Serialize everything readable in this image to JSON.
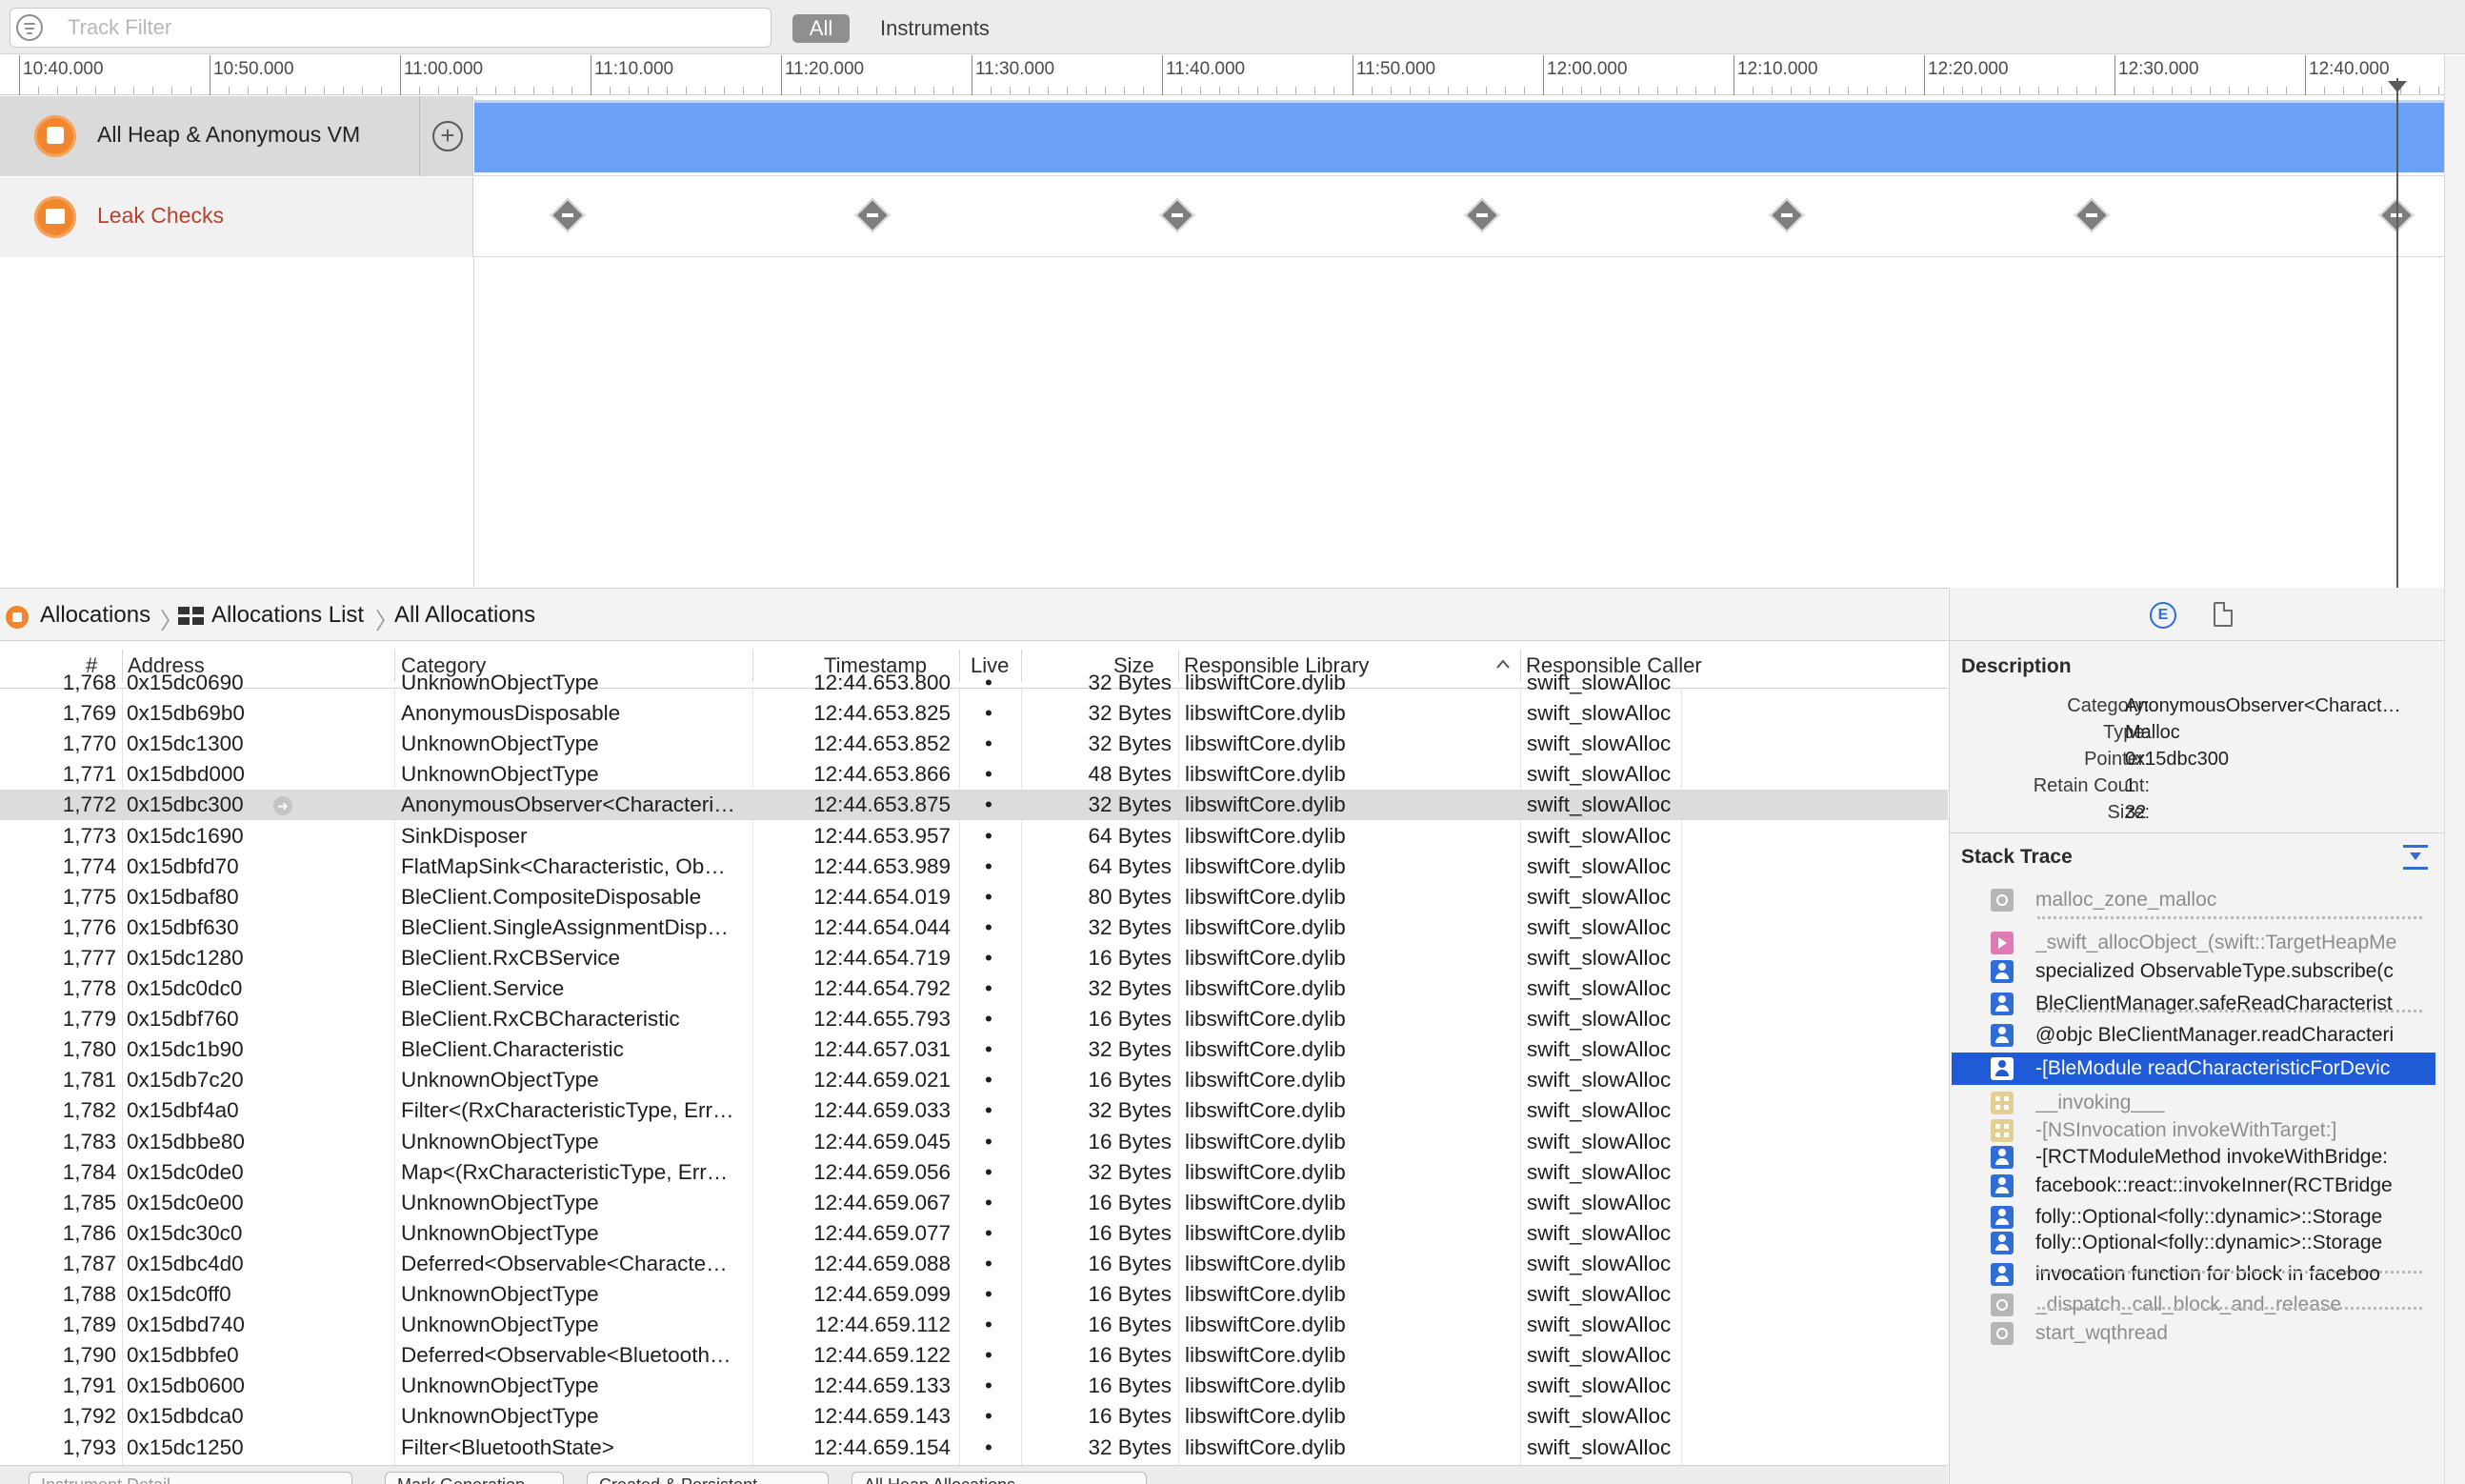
{
  "filter": {
    "placeholder": "Track Filter",
    "scope_all": "All",
    "scope_instruments": "Instruments"
  },
  "ruler": {
    "labels": [
      "10:40.000",
      "10:50.000",
      "11:00.000",
      "11:10.000",
      "11:20.000",
      "11:30.000",
      "11:40.000",
      "11:50.000",
      "12:00.000",
      "12:10.000",
      "12:20.000",
      "12:30.000",
      "12:40.000"
    ]
  },
  "tracks": [
    {
      "name": "All Heap & Anonymous VM",
      "icon": "allocations-icon",
      "color": "#6aa0f5"
    },
    {
      "name": "Leak Checks",
      "icon": "leaks-icon",
      "color": "#b5432b",
      "leak_check_count": 7
    }
  ],
  "jumpbar": {
    "seg1": "Allocations",
    "seg2": "Allocations List",
    "seg3": "All Allocations"
  },
  "table": {
    "headers": {
      "num": "#",
      "address": "Address",
      "category": "Category",
      "timestamp": "Timestamp",
      "live": "Live",
      "size": "Size",
      "library": "Responsible Library",
      "caller": "Responsible Caller"
    },
    "sorted_column": "Responsible Library",
    "rows": [
      {
        "num": "1,768",
        "address": "0x15dc0690",
        "category": "UnknownObjectType",
        "timestamp": "12:44.653.800",
        "live": "•",
        "size": "32 Bytes",
        "library": "libswiftCore.dylib",
        "caller": "swift_slowAlloc"
      },
      {
        "num": "1,769",
        "address": "0x15db69b0",
        "category": "AnonymousDisposable",
        "timestamp": "12:44.653.825",
        "live": "•",
        "size": "32 Bytes",
        "library": "libswiftCore.dylib",
        "caller": "swift_slowAlloc"
      },
      {
        "num": "1,770",
        "address": "0x15dc1300",
        "category": "UnknownObjectType",
        "timestamp": "12:44.653.852",
        "live": "•",
        "size": "32 Bytes",
        "library": "libswiftCore.dylib",
        "caller": "swift_slowAlloc"
      },
      {
        "num": "1,771",
        "address": "0x15dbd000",
        "category": "UnknownObjectType",
        "timestamp": "12:44.653.866",
        "live": "•",
        "size": "48 Bytes",
        "library": "libswiftCore.dylib",
        "caller": "swift_slowAlloc"
      },
      {
        "num": "1,772",
        "address": "0x15dbc300",
        "category": "AnonymousObserver<Characteri…",
        "timestamp": "12:44.653.875",
        "live": "•",
        "size": "32 Bytes",
        "library": "libswiftCore.dylib",
        "caller": "swift_slowAlloc",
        "selected": true
      },
      {
        "num": "1,773",
        "address": "0x15dc1690",
        "category": "SinkDisposer",
        "timestamp": "12:44.653.957",
        "live": "•",
        "size": "64 Bytes",
        "library": "libswiftCore.dylib",
        "caller": "swift_slowAlloc"
      },
      {
        "num": "1,774",
        "address": "0x15dbfd70",
        "category": "FlatMapSink<Characteristic, Ob…",
        "timestamp": "12:44.653.989",
        "live": "•",
        "size": "64 Bytes",
        "library": "libswiftCore.dylib",
        "caller": "swift_slowAlloc"
      },
      {
        "num": "1,775",
        "address": "0x15dbaf80",
        "category": "BleClient.CompositeDisposable",
        "timestamp": "12:44.654.019",
        "live": "•",
        "size": "80 Bytes",
        "library": "libswiftCore.dylib",
        "caller": "swift_slowAlloc"
      },
      {
        "num": "1,776",
        "address": "0x15dbf630",
        "category": "BleClient.SingleAssignmentDisp…",
        "timestamp": "12:44.654.044",
        "live": "•",
        "size": "32 Bytes",
        "library": "libswiftCore.dylib",
        "caller": "swift_slowAlloc"
      },
      {
        "num": "1,777",
        "address": "0x15dc1280",
        "category": "BleClient.RxCBService",
        "timestamp": "12:44.654.719",
        "live": "•",
        "size": "16 Bytes",
        "library": "libswiftCore.dylib",
        "caller": "swift_slowAlloc"
      },
      {
        "num": "1,778",
        "address": "0x15dc0dc0",
        "category": "BleClient.Service",
        "timestamp": "12:44.654.792",
        "live": "•",
        "size": "32 Bytes",
        "library": "libswiftCore.dylib",
        "caller": "swift_slowAlloc"
      },
      {
        "num": "1,779",
        "address": "0x15dbf760",
        "category": "BleClient.RxCBCharacteristic",
        "timestamp": "12:44.655.793",
        "live": "•",
        "size": "16 Bytes",
        "library": "libswiftCore.dylib",
        "caller": "swift_slowAlloc"
      },
      {
        "num": "1,780",
        "address": "0x15dc1b90",
        "category": "BleClient.Characteristic",
        "timestamp": "12:44.657.031",
        "live": "•",
        "size": "32 Bytes",
        "library": "libswiftCore.dylib",
        "caller": "swift_slowAlloc"
      },
      {
        "num": "1,781",
        "address": "0x15db7c20",
        "category": "UnknownObjectType",
        "timestamp": "12:44.659.021",
        "live": "•",
        "size": "16 Bytes",
        "library": "libswiftCore.dylib",
        "caller": "swift_slowAlloc"
      },
      {
        "num": "1,782",
        "address": "0x15dbf4a0",
        "category": "Filter<(RxCharacteristicType, Err…",
        "timestamp": "12:44.659.033",
        "live": "•",
        "size": "32 Bytes",
        "library": "libswiftCore.dylib",
        "caller": "swift_slowAlloc"
      },
      {
        "num": "1,783",
        "address": "0x15dbbe80",
        "category": "UnknownObjectType",
        "timestamp": "12:44.659.045",
        "live": "•",
        "size": "16 Bytes",
        "library": "libswiftCore.dylib",
        "caller": "swift_slowAlloc"
      },
      {
        "num": "1,784",
        "address": "0x15dc0de0",
        "category": "Map<(RxCharacteristicType, Err…",
        "timestamp": "12:44.659.056",
        "live": "•",
        "size": "32 Bytes",
        "library": "libswiftCore.dylib",
        "caller": "swift_slowAlloc"
      },
      {
        "num": "1,785",
        "address": "0x15dc0e00",
        "category": "UnknownObjectType",
        "timestamp": "12:44.659.067",
        "live": "•",
        "size": "16 Bytes",
        "library": "libswiftCore.dylib",
        "caller": "swift_slowAlloc"
      },
      {
        "num": "1,786",
        "address": "0x15dc30c0",
        "category": "UnknownObjectType",
        "timestamp": "12:44.659.077",
        "live": "•",
        "size": "16 Bytes",
        "library": "libswiftCore.dylib",
        "caller": "swift_slowAlloc"
      },
      {
        "num": "1,787",
        "address": "0x15dbc4d0",
        "category": "Deferred<Observable<Characte…",
        "timestamp": "12:44.659.088",
        "live": "•",
        "size": "16 Bytes",
        "library": "libswiftCore.dylib",
        "caller": "swift_slowAlloc"
      },
      {
        "num": "1,788",
        "address": "0x15dc0ff0",
        "category": "UnknownObjectType",
        "timestamp": "12:44.659.099",
        "live": "•",
        "size": "16 Bytes",
        "library": "libswiftCore.dylib",
        "caller": "swift_slowAlloc"
      },
      {
        "num": "1,789",
        "address": "0x15dbd740",
        "category": "UnknownObjectType",
        "timestamp": "12:44.659.112",
        "live": "•",
        "size": "16 Bytes",
        "library": "libswiftCore.dylib",
        "caller": "swift_slowAlloc"
      },
      {
        "num": "1,790",
        "address": "0x15dbbfe0",
        "category": "Deferred<Observable<Bluetooth…",
        "timestamp": "12:44.659.122",
        "live": "•",
        "size": "16 Bytes",
        "library": "libswiftCore.dylib",
        "caller": "swift_slowAlloc"
      },
      {
        "num": "1,791",
        "address": "0x15db0600",
        "category": "UnknownObjectType",
        "timestamp": "12:44.659.133",
        "live": "•",
        "size": "16 Bytes",
        "library": "libswiftCore.dylib",
        "caller": "swift_slowAlloc"
      },
      {
        "num": "1,792",
        "address": "0x15dbdca0",
        "category": "UnknownObjectType",
        "timestamp": "12:44.659.143",
        "live": "•",
        "size": "16 Bytes",
        "library": "libswiftCore.dylib",
        "caller": "swift_slowAlloc"
      },
      {
        "num": "1,793",
        "address": "0x15dc1250",
        "category": "Filter<BluetoothState>",
        "timestamp": "12:44.659.154",
        "live": "•",
        "size": "32 Bytes",
        "library": "libswiftCore.dylib",
        "caller": "swift_slowAlloc"
      }
    ]
  },
  "statusbar": {
    "filter_placeholder": "Instrument Detail",
    "mark": "Mark Generation",
    "created": "Created & Persistent",
    "all_heap": "All Heap Allocations"
  },
  "inspector": {
    "description_title": "Description",
    "description": [
      {
        "key": "Category:",
        "value": "AnonymousObserver<Charact…"
      },
      {
        "key": "Type:",
        "value": "Malloc"
      },
      {
        "key": "Pointer:",
        "value": "0x15dbc300"
      },
      {
        "key": "Retain Count:",
        "value": "1"
      },
      {
        "key": "Size:",
        "value": "32"
      }
    ],
    "stack_title": "Stack Trace",
    "frames": [
      {
        "text": "malloc_zone_malloc",
        "icon": "system-library-icon",
        "kind": "sys",
        "dim": true
      },
      {
        "text": "_swift_allocObject_(swift::TargetHeapMe",
        "icon": "swift-runtime-icon",
        "kind": "swift",
        "dim": true
      },
      {
        "text": "specialized ObservableType.subscribe(c",
        "icon": "user-code-icon",
        "kind": "user"
      },
      {
        "text": "BleClientManager.safeReadCharacterist",
        "icon": "user-code-icon",
        "kind": "user"
      },
      {
        "text": "@objc BleClientManager.readCharacteri",
        "icon": "user-code-icon",
        "kind": "user"
      },
      {
        "text": "-[BleModule readCharacteristicForDevic",
        "icon": "user-code-icon",
        "kind": "user",
        "selected": true
      },
      {
        "text": "__invoking___",
        "icon": "framework-icon",
        "kind": "fw",
        "dim": true
      },
      {
        "text": "-[NSInvocation invokeWithTarget:]",
        "icon": "framework-icon",
        "kind": "fw",
        "dim": true
      },
      {
        "text": "-[RCTModuleMethod invokeWithBridge:",
        "icon": "user-code-icon",
        "kind": "user"
      },
      {
        "text": "facebook::react::invokeInner(RCTBridge",
        "icon": "user-code-icon",
        "kind": "user"
      },
      {
        "text": "folly::Optional<folly::dynamic>::Storage",
        "icon": "user-code-icon",
        "kind": "user"
      },
      {
        "text": "folly::Optional<folly::dynamic>::Storage",
        "icon": "user-code-icon",
        "kind": "user"
      },
      {
        "text": "invocation function for block in faceboo",
        "icon": "user-code-icon",
        "kind": "user"
      },
      {
        "text": "_dispatch_call_block_and_release",
        "icon": "system-library-icon",
        "kind": "sys",
        "dim": true
      },
      {
        "text": "start_wqthread",
        "icon": "system-library-icon",
        "kind": "sys",
        "dim": true
      }
    ]
  },
  "colors": {
    "heap_bar": "#6aa0f5",
    "selection_blue": "#1f5bd6",
    "accent_blue": "#2f6ed9",
    "instrument_orange": "#f0872f",
    "leak_text": "#b5432b"
  }
}
